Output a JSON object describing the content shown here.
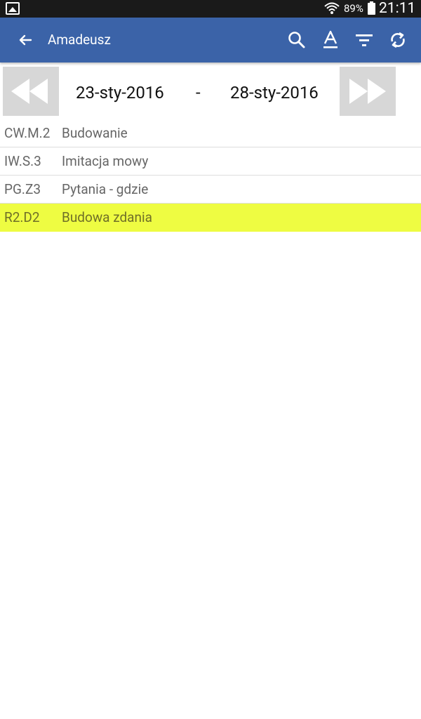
{
  "status_bar": {
    "battery_percent": "89%",
    "time": "21:11",
    "icons": [
      "gallery-icon",
      "wifi-icon",
      "battery-icon"
    ]
  },
  "app_bar": {
    "title": "Amadeusz",
    "background_color": "#3b63a8",
    "actions": [
      "back-arrow-icon",
      "search-icon",
      "font-icon",
      "filter-icon",
      "sync-icon"
    ]
  },
  "date_range": {
    "start": "23-sty-2016",
    "separator": "-",
    "end": "28-sty-2016",
    "prev_icon": "rewind-icon",
    "next_icon": "fast-forward-icon"
  },
  "list": {
    "items": [
      {
        "code": "CW.M.2",
        "name": "Budowanie",
        "highlighted": false
      },
      {
        "code": "IW.S.3",
        "name": "Imitacja mowy",
        "highlighted": false
      },
      {
        "code": "PG.Z3",
        "name": "Pytania - gdzie",
        "highlighted": false
      },
      {
        "code": "R2.D2",
        "name": "Budowa zdania",
        "highlighted": true
      }
    ],
    "highlight_color": "#eefc42"
  }
}
